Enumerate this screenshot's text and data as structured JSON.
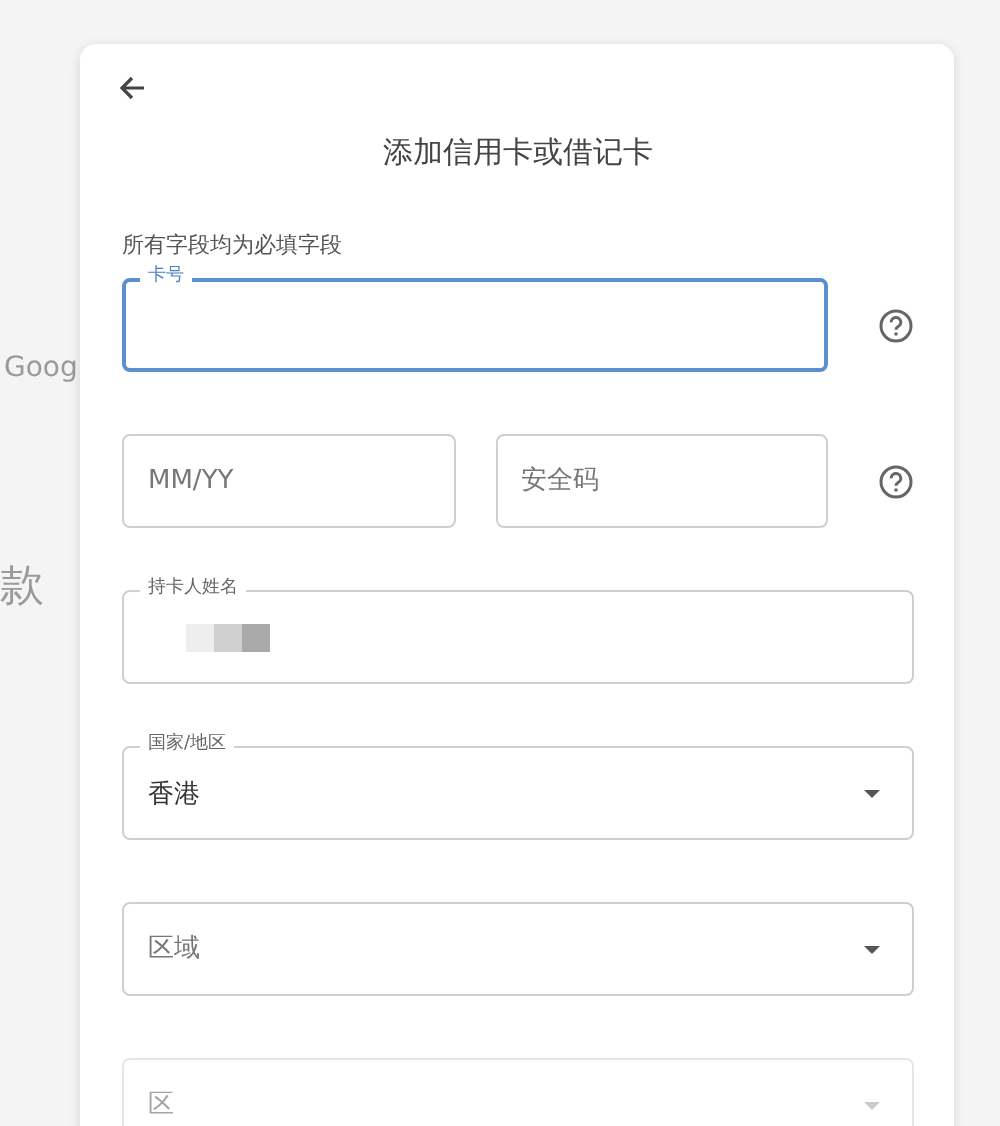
{
  "background": {
    "texts": [
      "Goog",
      "款"
    ]
  },
  "dialog": {
    "title": "添加信用卡或借记卡",
    "note": "所有字段均为必填字段",
    "rows": [
      {
        "help": true,
        "fields": [
          {
            "kind": "text",
            "label": "卡号",
            "focused": true,
            "disabled": false
          }
        ]
      },
      {
        "help": true,
        "fields": [
          {
            "kind": "text",
            "placeholder": "MM/YY",
            "focused": false,
            "disabled": false
          },
          {
            "kind": "text",
            "placeholder": "安全码",
            "focused": false,
            "disabled": false
          }
        ]
      },
      {
        "help": false,
        "fields": [
          {
            "kind": "text",
            "label": "持卡人姓名",
            "redacted": true,
            "focused": false,
            "disabled": false
          }
        ]
      },
      {
        "help": false,
        "fields": [
          {
            "kind": "select",
            "label": "国家/地区",
            "value": "香港",
            "focused": false,
            "disabled": false
          }
        ]
      },
      {
        "help": false,
        "fields": [
          {
            "kind": "select",
            "placeholder": "区域",
            "focused": false,
            "disabled": false
          }
        ]
      },
      {
        "help": false,
        "fields": [
          {
            "kind": "select",
            "placeholder": "区",
            "focused": false,
            "disabled": true
          }
        ]
      }
    ]
  }
}
